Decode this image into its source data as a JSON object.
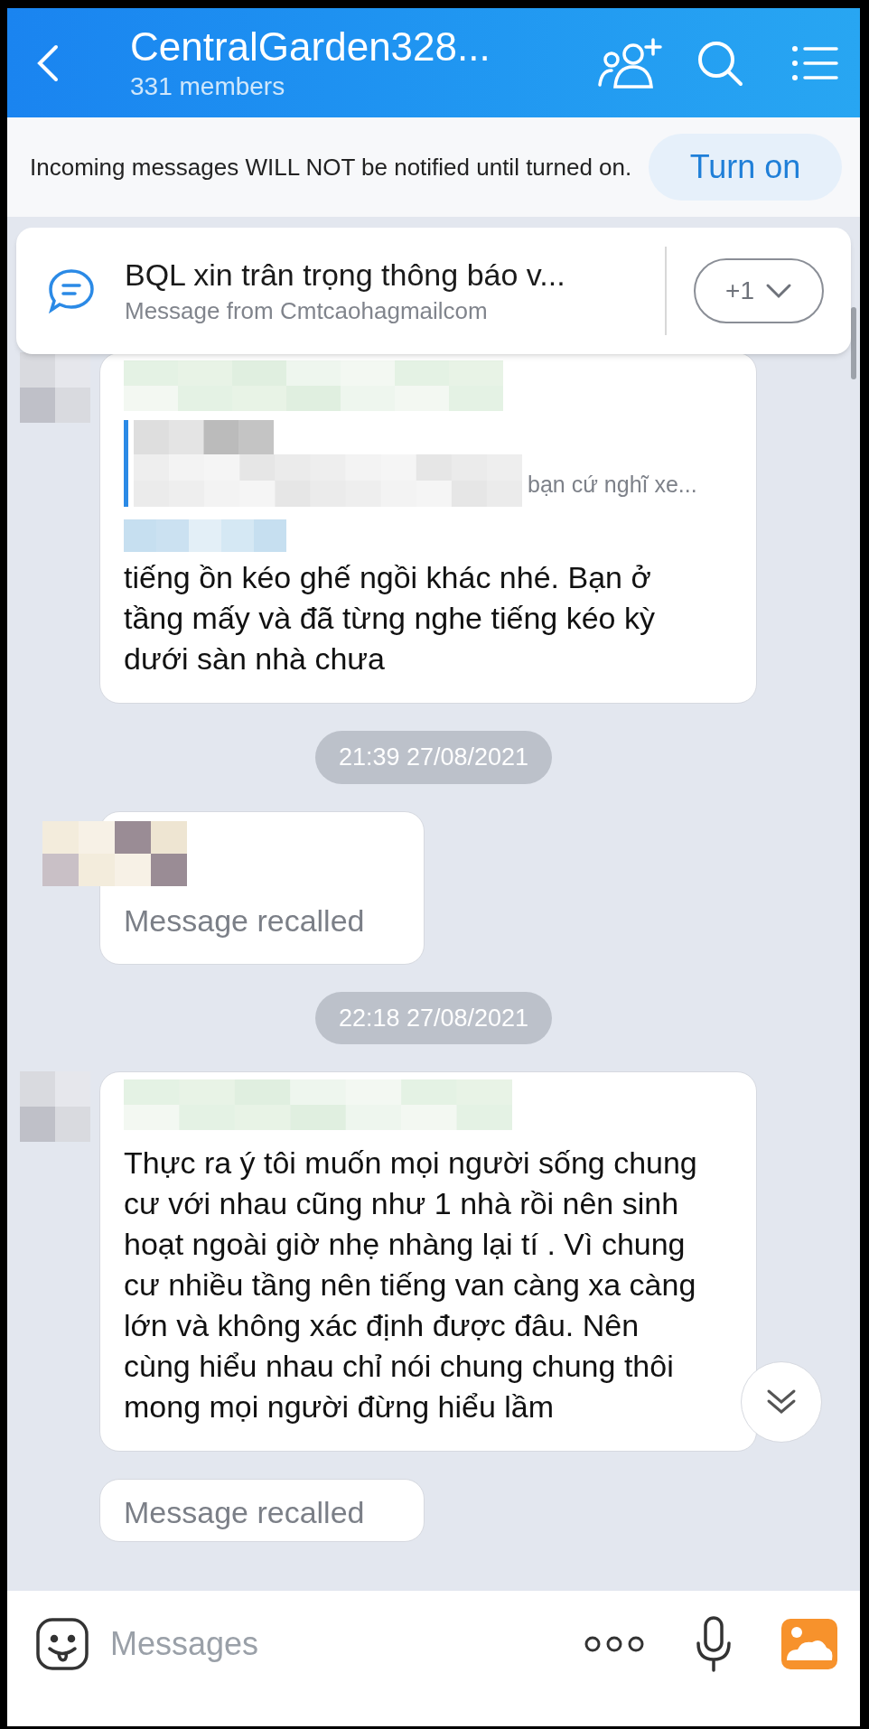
{
  "header": {
    "title": "CentralGarden328...",
    "subtitle": "331 members"
  },
  "notice": {
    "text": "Incoming messages WILL NOT be notified until turned on.",
    "button": "Turn on"
  },
  "pinned": {
    "title": "BQL xin trân trọng thông báo v...",
    "subtitle": "Message from Cmtcaohagmailcom",
    "count": "+1"
  },
  "messages": [
    {
      "kind": "message",
      "quote": "bạn cứ nghĩ xe...",
      "text": "tiếng ồn kéo ghế ngồi khác nhé. Bạn ở tầng mấy và đã từng nghe tiếng kéo kỳ dưới sàn nhà chưa"
    },
    {
      "kind": "time",
      "text": "21:39 27/08/2021"
    },
    {
      "kind": "recalled",
      "text": "Message recalled"
    },
    {
      "kind": "time",
      "text": "22:18 27/08/2021"
    },
    {
      "kind": "message",
      "text": "Thực ra ý tôi muốn mọi người sống chung cư với nhau cũng như 1 nhà rồi nên sinh hoạt ngoài giờ nhẹ nhàng lại tí . Vì chung cư nhiều tầng nên tiếng van càng xa càng lớn và không xác định được đâu. Nên cùng hiểu nhau chỉ nói chung chung thôi mong mọi người đừng hiểu lầm"
    },
    {
      "kind": "recalled",
      "text": "Message recalled"
    }
  ],
  "composer": {
    "placeholder": "Messages"
  }
}
